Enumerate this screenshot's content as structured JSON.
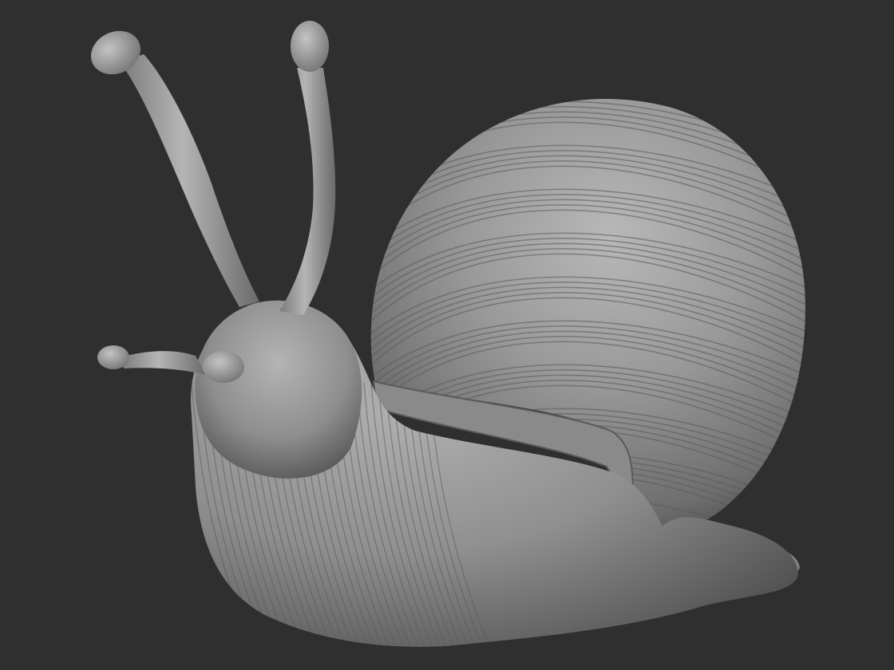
{
  "scene": {
    "background_color": "#2f2f2f",
    "subject": "snail-sculpt",
    "material": "matcap-gray",
    "colors": {
      "highlight": "#bdbdbd",
      "midtone": "#8c8c8c",
      "shadow": "#4a4a4a",
      "groove": "#5a5a5a"
    }
  }
}
